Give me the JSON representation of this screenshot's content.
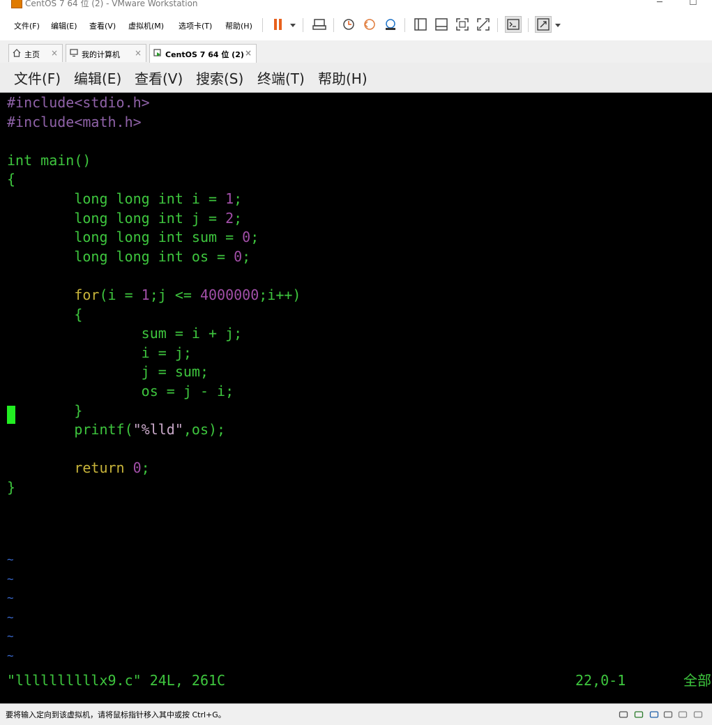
{
  "window": {
    "title": "CentOS 7 64 位 (2) - VMware Workstation",
    "minimize": "─",
    "maximize": "☐"
  },
  "menubar": {
    "items": [
      "文件(F)",
      "编辑(E)",
      "查看(V)",
      "虚拟机(M)",
      "选项卡(T)",
      "帮助(H)"
    ]
  },
  "toolbar": {
    "buttons": [
      "pause",
      "send-ctrl-alt-del",
      "snapshot-take",
      "snapshot-revert",
      "snapshot-manager",
      "view-library",
      "view-thumbnail",
      "full-screen",
      "unity",
      "console-view",
      "stretch-view"
    ],
    "accent": "#e8601c"
  },
  "tabs": [
    {
      "label": "主页",
      "icon": "home-icon",
      "active": false
    },
    {
      "label": "我的计算机",
      "icon": "monitor-icon",
      "active": false
    },
    {
      "label": "CentOS 7 64 位 (2)",
      "icon": "vm-icon",
      "active": true
    }
  ],
  "tab_close": "×",
  "guest_menu": {
    "items": [
      "文件(F)",
      "编辑(E)",
      "查看(V)",
      "搜索(S)",
      "终端(T)",
      "帮助(H)"
    ]
  },
  "editor": {
    "lines": [
      [
        {
          "t": "#include",
          "c": "pre"
        },
        {
          "t": "<stdio.h>",
          "c": "pre"
        }
      ],
      [
        {
          "t": "#include",
          "c": "pre"
        },
        {
          "t": "<math.h>",
          "c": "pre"
        }
      ],
      [],
      [
        {
          "t": "int main()",
          "c": "kw"
        }
      ],
      [
        {
          "t": "{",
          "c": "kw"
        }
      ],
      [
        {
          "t": "        long long int ",
          "c": "kw"
        },
        {
          "t": "i = ",
          "c": "var"
        },
        {
          "t": "1",
          "c": "num"
        },
        {
          "t": ";",
          "c": "var"
        }
      ],
      [
        {
          "t": "        long long int ",
          "c": "kw"
        },
        {
          "t": "j = ",
          "c": "var"
        },
        {
          "t": "2",
          "c": "num"
        },
        {
          "t": ";",
          "c": "var"
        }
      ],
      [
        {
          "t": "        long long int ",
          "c": "kw"
        },
        {
          "t": "sum = ",
          "c": "var"
        },
        {
          "t": "0",
          "c": "num"
        },
        {
          "t": ";",
          "c": "var"
        }
      ],
      [
        {
          "t": "        long long int ",
          "c": "kw"
        },
        {
          "t": "os = ",
          "c": "var"
        },
        {
          "t": "0",
          "c": "num"
        },
        {
          "t": ";",
          "c": "var"
        }
      ],
      [],
      [
        {
          "t": "        ",
          "c": "var"
        },
        {
          "t": "for",
          "c": "ctl"
        },
        {
          "t": "(i = ",
          "c": "var"
        },
        {
          "t": "1",
          "c": "num"
        },
        {
          "t": ";j <= ",
          "c": "var"
        },
        {
          "t": "4000000",
          "c": "num"
        },
        {
          "t": ";i++)",
          "c": "var"
        }
      ],
      [
        {
          "t": "        {",
          "c": "kw"
        }
      ],
      [
        {
          "t": "                sum = i + j;",
          "c": "var"
        }
      ],
      [
        {
          "t": "                i = j;",
          "c": "var"
        }
      ],
      [
        {
          "t": "                j = sum;",
          "c": "var"
        }
      ],
      [
        {
          "t": "                os = j - i;",
          "c": "var"
        }
      ],
      [
        {
          "t": "        }",
          "c": "kw"
        }
      ],
      [
        {
          "t": "        printf(",
          "c": "var"
        },
        {
          "t": "\"%lld\"",
          "c": "str"
        },
        {
          "t": ",os);",
          "c": "var"
        }
      ],
      [],
      [
        {
          "t": "        ",
          "c": "var"
        },
        {
          "t": "return",
          "c": "ctl"
        },
        {
          "t": " ",
          "c": "var"
        },
        {
          "t": "0",
          "c": "num"
        },
        {
          "t": ";",
          "c": "var"
        }
      ],
      [
        {
          "t": "}",
          "c": "kw"
        }
      ]
    ],
    "tilde_count": 6,
    "tilde": "~",
    "status_left": "\"llllllllllx9.c\" 24L, 261C",
    "status_pos": "22,0-1",
    "status_right": "全部"
  },
  "statusbar": {
    "message": "要将输入定向到该虚拟机，请将鼠标指针移入其中或按 Ctrl+G。",
    "icons": [
      "hdd-icon",
      "cdrom-icon",
      "network-icon",
      "printer-icon",
      "sound-icon",
      "usb-icon"
    ]
  }
}
